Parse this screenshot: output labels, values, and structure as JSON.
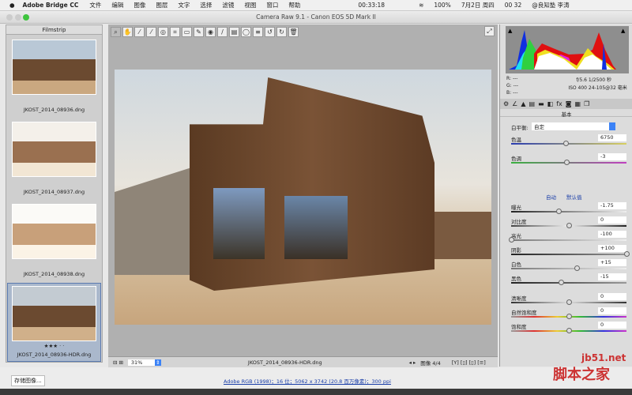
{
  "menubar": {
    "app": "Adobe Bridge CC",
    "items": [
      "文件",
      "编辑",
      "图像",
      "图层",
      "文字",
      "选择",
      "滤镜",
      "视图",
      "窗口",
      "帮助"
    ],
    "timer": "00:33:18",
    "battery": "100%",
    "date": "7月2日 周四",
    "time": "00 32",
    "user": "@良知塾 李涛"
  },
  "window": {
    "title": "Camera Raw 9.1 - Canon EOS 5D Mark II"
  },
  "filmstrip": {
    "title": "Filmstrip",
    "items": [
      {
        "name": "JKOST_2014_08936.dng"
      },
      {
        "name": "JKOST_2014_08937.dng"
      },
      {
        "name": "JKOST_2014_08938.dng"
      },
      {
        "name": "JKOST_2014_08936-HDR.dng",
        "rating": "★★★ · ·",
        "selected": true
      }
    ]
  },
  "toolbar": {
    "tools": [
      "zoom",
      "hand",
      "white-balance",
      "color-sampler",
      "targeted-adjustment",
      "crop",
      "straighten",
      "spot-removal",
      "red-eye",
      "adjustment-brush",
      "graduated-filter",
      "radial-filter",
      "preferences",
      "rotate-left",
      "rotate-right",
      "trash"
    ]
  },
  "bottombar": {
    "zoom": "31%",
    "filename": "JKOST_2014_08936-HDR.dng",
    "counter": "图像 4/4"
  },
  "info": {
    "r_label": "R:",
    "g_label": "G:",
    "b_label": "B:",
    "r": "---",
    "g": "---",
    "b": "---",
    "aperture": "f/5.6",
    "shutter": "1/2500 秒",
    "iso": "ISO 400",
    "lens": "24-105@32 毫米"
  },
  "panel": {
    "title": "基本",
    "wb_label": "白平衡:",
    "wb_value": "自定",
    "auto": "自动",
    "default": "默认值",
    "sliders": [
      {
        "label": "色温",
        "value": "6750",
        "pos": 0.47,
        "track": "linear-gradient(90deg,#2a3cb0,#d8d060)"
      },
      {
        "label": "色调",
        "value": "-3",
        "pos": 0.48,
        "track": "linear-gradient(90deg,#3ab040,#c040c0)"
      },
      {
        "label": "曝光",
        "value": "-1.75",
        "pos": 0.41,
        "track": "linear-gradient(90deg,#222,#eee)"
      },
      {
        "label": "对比度",
        "value": "0",
        "pos": 0.5,
        "track": "linear-gradient(90deg,#444,#eee,#222)"
      },
      {
        "label": "高光",
        "value": "-100",
        "pos": 0.0,
        "track": "linear-gradient(90deg,#777,#eee)"
      },
      {
        "label": "阴影",
        "value": "+100",
        "pos": 1.0,
        "track": "linear-gradient(90deg,#222,#999)"
      },
      {
        "label": "白色",
        "value": "+15",
        "pos": 0.57,
        "track": "linear-gradient(90deg,#777,#eee)"
      },
      {
        "label": "黑色",
        "value": "-15",
        "pos": 0.43,
        "track": "linear-gradient(90deg,#222,#999)"
      },
      {
        "label": "清晰度",
        "value": "0",
        "pos": 0.5,
        "track": "linear-gradient(90deg,#333,#ddd,#333)"
      },
      {
        "label": "自然饱和度",
        "value": "0",
        "pos": 0.5,
        "track": "linear-gradient(90deg,#999,#d33,#ec3,#3b3,#33d,#c3c)"
      },
      {
        "label": "饱和度",
        "value": "0",
        "pos": 0.5,
        "track": "linear-gradient(90deg,#999,#d33,#ec3,#3b3,#33d,#c3c)"
      }
    ]
  },
  "status": {
    "save": "存储图像...",
    "workflow": "Adobe RGB (1998)；16 位；5062 x 3742 (20.8 百万像素)；300 ppi"
  },
  "watermark": {
    "site": "jb51.net",
    "name": "脚本之家"
  }
}
